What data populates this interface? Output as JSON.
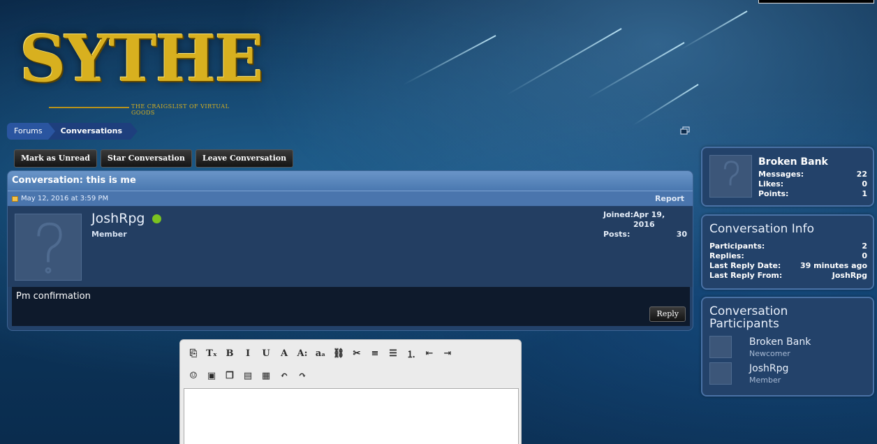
{
  "logo": {
    "word": "SYTHE",
    "tagline": "THE CRAIGSLIST OF VIRTUAL GOODS"
  },
  "breadcrumb": [
    {
      "label": "Forums"
    },
    {
      "label": "Conversations"
    }
  ],
  "actions": {
    "mark_unread": "Mark as Unread",
    "star": "Star Conversation",
    "leave": "Leave Conversation"
  },
  "conversation": {
    "title": "Conversation: this is me",
    "date": "May 12, 2016 at 3:59 PM",
    "report": "Report",
    "post": {
      "username": "JoshRpg",
      "user_title": "Member",
      "joined_label": "Joined:",
      "joined_value": "Apr 19, 2016",
      "posts_label": "Posts:",
      "posts_value": "30",
      "message": "Pm confirmation",
      "reply": "Reply"
    }
  },
  "sidebar": {
    "user": {
      "name": "Broken Bank",
      "stats": [
        {
          "label": "Messages:",
          "value": "22"
        },
        {
          "label": "Likes:",
          "value": "0"
        },
        {
          "label": "Points:",
          "value": "1"
        }
      ]
    },
    "info": {
      "title": "Conversation Info",
      "rows": [
        {
          "label": "Participants:",
          "value": "2"
        },
        {
          "label": "Replies:",
          "value": "0"
        },
        {
          "label": "Last Reply Date:",
          "value": "39 minutes ago"
        },
        {
          "label": "Last Reply From:",
          "value": "JoshRpg"
        }
      ]
    },
    "participants": {
      "title_line1": "Conversation",
      "title_line2": "Participants",
      "list": [
        {
          "name": "Broken Bank",
          "role": "Newcomer"
        },
        {
          "name": "JoshRpg",
          "role": "Member"
        }
      ]
    }
  },
  "editor": {
    "row1": [
      {
        "icon": "remove-format-icon",
        "glyph": "⎘"
      },
      {
        "icon": "clear-format-icon",
        "glyph": "Tₓ"
      },
      {
        "icon": "bold-icon",
        "glyph": "B"
      },
      {
        "icon": "italic-icon",
        "glyph": "I"
      },
      {
        "icon": "underline-icon",
        "glyph": "U"
      },
      {
        "icon": "font-color-icon",
        "glyph": "A"
      },
      {
        "icon": "font-size-icon",
        "glyph": "A:"
      },
      {
        "icon": "font-family-icon",
        "glyph": "aₐ"
      },
      {
        "icon": "link-icon",
        "glyph": "⛓"
      },
      {
        "icon": "unlink-icon",
        "glyph": "✂"
      },
      {
        "icon": "align-icon",
        "glyph": "≡"
      },
      {
        "icon": "bullet-list-icon",
        "glyph": "☰"
      },
      {
        "icon": "numbered-list-icon",
        "glyph": "⒈"
      },
      {
        "icon": "outdent-icon",
        "glyph": "⇤"
      },
      {
        "icon": "indent-icon",
        "glyph": "⇥"
      }
    ],
    "row2": [
      {
        "icon": "smiley-icon",
        "glyph": "☺"
      },
      {
        "icon": "image-icon",
        "glyph": "▣"
      },
      {
        "icon": "media-icon",
        "glyph": "❐"
      },
      {
        "icon": "code-icon",
        "glyph": "▤"
      },
      {
        "icon": "save-draft-icon",
        "glyph": "▦"
      },
      {
        "icon": "undo-icon",
        "glyph": "↶"
      },
      {
        "icon": "redo-icon",
        "glyph": "↷"
      }
    ]
  }
}
